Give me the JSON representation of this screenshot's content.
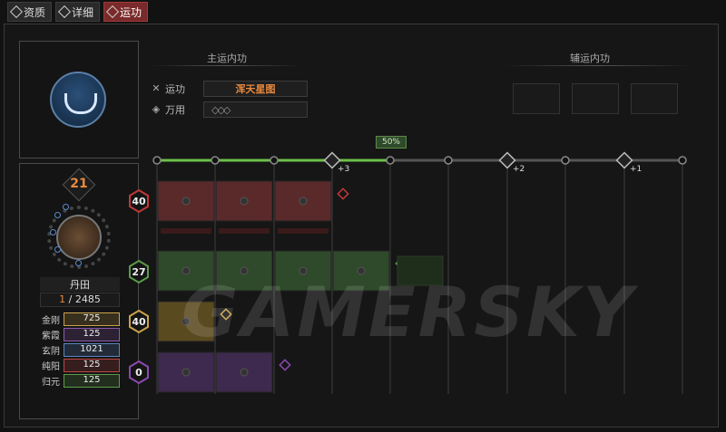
{
  "tabs": [
    {
      "label": "资质",
      "icon": "attribute-icon",
      "active": false
    },
    {
      "label": "详细",
      "icon": "detail-icon",
      "active": false
    },
    {
      "label": "运功",
      "icon": "cultivate-icon",
      "active": true
    }
  ],
  "main_section": {
    "title": "主运内功"
  },
  "aux_section": {
    "title": "辅运内功"
  },
  "fields": {
    "yungong_label": "运功",
    "yungong_value": "浑天星图",
    "wanyong_label": "万用"
  },
  "progress": {
    "label": "50%",
    "fraction": 0.5
  },
  "milestones": [
    "+3",
    "+2",
    "+1"
  ],
  "character": {
    "level": "21",
    "dantian_label": "丹田",
    "dantian_current": "1",
    "dantian_max": "2485"
  },
  "attributes": [
    {
      "name": "金刚",
      "value": "725",
      "color": "#c9a24a"
    },
    {
      "name": "紫霞",
      "value": "125",
      "color": "#8a5ab0"
    },
    {
      "name": "玄阴",
      "value": "1021",
      "color": "#5b86c4"
    },
    {
      "name": "纯阳",
      "value": "125",
      "color": "#c04545"
    },
    {
      "name": "归元",
      "value": "125",
      "color": "#5c9a4a"
    }
  ],
  "rows": [
    {
      "value": "40",
      "color": "#c03838",
      "slots": 3
    },
    {
      "value": "27",
      "color": "#5a9a4a",
      "slots": 4
    },
    {
      "value": "40",
      "color": "#c9a24a",
      "slots": 1
    },
    {
      "value": "0",
      "color": "#8a4ab0",
      "slots": 2
    }
  ],
  "watermark": "GAMERSKY"
}
